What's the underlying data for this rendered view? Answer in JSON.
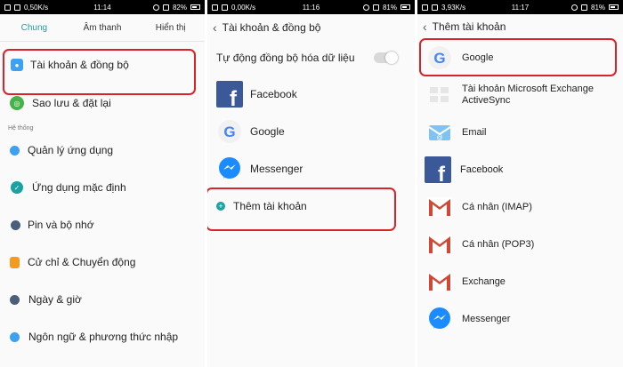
{
  "screens": [
    {
      "status": {
        "speed": "0,50K/s",
        "time": "11:14",
        "battery": "82%"
      },
      "tabs": [
        "Chung",
        "Âm thanh",
        "Hiển thị"
      ],
      "items_top": [
        {
          "label": "Tài khoản & đồng bộ",
          "icon": "account-icon",
          "color": "#3ea0f0"
        },
        {
          "label": "Sao lưu & đặt lại",
          "icon": "backup-icon",
          "color": "#47b14a"
        }
      ],
      "section": "Hệ thống",
      "items_system": [
        {
          "label": "Quản lý ứng dụng",
          "icon": "app-manager-icon",
          "color": "#3ea0f0"
        },
        {
          "label": "Ứng dụng mặc định",
          "icon": "default-apps-icon",
          "color": "#1aa1a0"
        },
        {
          "label": "Pin và bộ nhớ",
          "icon": "battery-memory-icon",
          "color": "#4b5e7b"
        },
        {
          "label": "Cử chỉ & Chuyển động",
          "icon": "gesture-icon",
          "color": "#f39a20"
        },
        {
          "label": "Ngày & giờ",
          "icon": "clock-icon",
          "color": "#4b5e7b"
        },
        {
          "label": "Ngôn ngữ & phương thức nhập",
          "icon": "language-icon",
          "color": "#3ea0f0"
        }
      ]
    },
    {
      "status": {
        "speed": "0,00K/s",
        "time": "11:16",
        "battery": "81%"
      },
      "title": "Tài khoản & đồng bộ",
      "auto_sync": "Tự động đồng bộ hóa dữ liệu",
      "accounts": [
        {
          "label": "Facebook",
          "icon": "facebook-icon"
        },
        {
          "label": "Google",
          "icon": "google-icon"
        },
        {
          "label": "Messenger",
          "icon": "messenger-icon"
        }
      ],
      "add_account": "Thêm tài khoản"
    },
    {
      "status": {
        "speed": "3,93K/s",
        "time": "11:17",
        "battery": "81%"
      },
      "title": "Thêm tài khoản",
      "providers": [
        {
          "label": "Google",
          "icon": "google-icon"
        },
        {
          "label": "Tài khoản Microsoft Exchange ActiveSync",
          "icon": "exchange-icon"
        },
        {
          "label": "Email",
          "icon": "email-icon"
        },
        {
          "label": "Facebook",
          "icon": "facebook-icon"
        },
        {
          "label": "Cá nhân (IMAP)",
          "icon": "gmail-icon"
        },
        {
          "label": "Cá nhân (POP3)",
          "icon": "gmail-icon"
        },
        {
          "label": "Exchange",
          "icon": "gmail-icon"
        },
        {
          "label": "Messenger",
          "icon": "messenger-icon"
        }
      ]
    }
  ],
  "colors": {
    "accent": "#1aa1a0",
    "highlight": "#d8232a",
    "facebook": "#3b5998",
    "messenger": "#1a8cff"
  }
}
